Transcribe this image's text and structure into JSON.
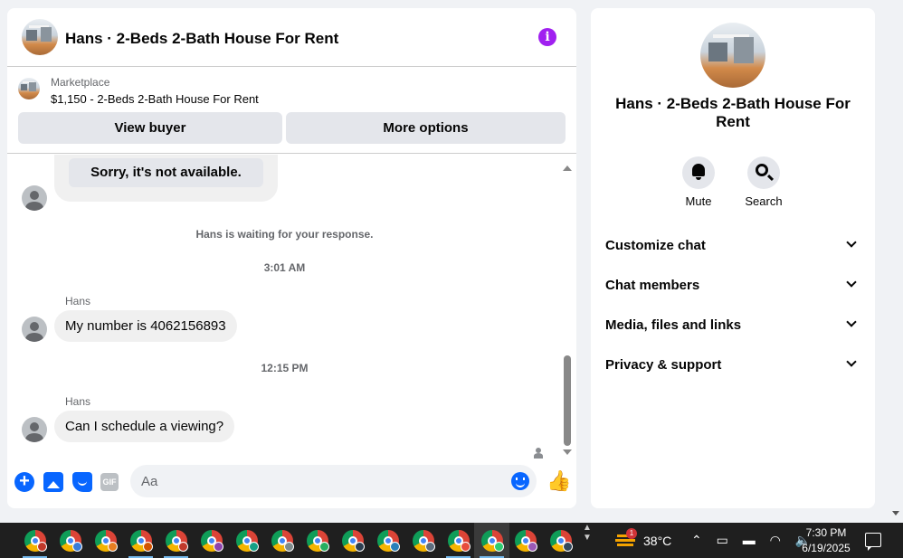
{
  "chat": {
    "title": "Hans · 2-Beds 2-Bath House For Rent",
    "marketplace_label": "Marketplace",
    "listing": "$1,150 - 2-Beds 2-Bath House For Rent",
    "view_buyer": "View buyer",
    "more_options": "More options"
  },
  "messages": {
    "quick_reply": "Sorry, it's not available.",
    "waiting": "Hans is waiting for your response.",
    "time1": "3:01 AM",
    "sender1": "Hans",
    "msg1": "My number is 4062156893",
    "time2": "12:15 PM",
    "sender2": "Hans",
    "msg2": "Can I schedule a viewing?"
  },
  "composer": {
    "placeholder": "Aa",
    "gif_label": "GIF"
  },
  "side": {
    "title": "Hans · 2-Beds 2-Bath House For Rent",
    "mute": "Mute",
    "search": "Search",
    "sections": [
      "Customize chat",
      "Chat members",
      "Media, files and links",
      "Privacy & support"
    ]
  },
  "taskbar": {
    "weather_badge": "1",
    "temperature": "38°C",
    "time": "7:30 PM",
    "date": "6/19/2025"
  },
  "colors": {
    "accent": "#0866ff",
    "info": "#a020f0"
  }
}
